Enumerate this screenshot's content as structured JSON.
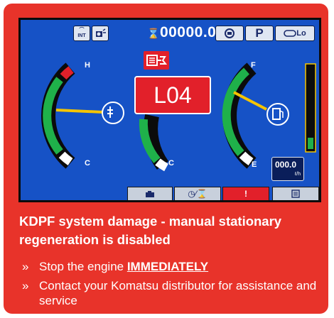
{
  "display": {
    "odometer": "00000.0",
    "odometer_unit": "h",
    "mode_p": "P",
    "mode_lo": "Lo",
    "int_label": "INT",
    "alert_code": "L04",
    "rate_value": "000.0",
    "rate_unit": "ℓ/h",
    "gauge_letters": {
      "coolant_high": "H",
      "coolant_cold": "C",
      "hyd_cold": "C",
      "fuel_full": "F",
      "fuel_empty": "E"
    },
    "bottom_buttons": [
      {
        "icon": "camera-icon"
      },
      {
        "icon": "clock-hourglass-icon"
      },
      {
        "label": "!"
      },
      {
        "icon": "list-icon"
      }
    ],
    "colors": {
      "screen_bg": "#1652c6",
      "alert_red": "#e2202a",
      "card_red": "#e8332a",
      "gauge_green": "#1fb14a",
      "needle": "#f5c400"
    }
  },
  "message": {
    "title": "KDPF system damage - manual stationary regeneration is disabled",
    "bullets": [
      {
        "prefix": "Stop the engine ",
        "strong": "IMMEDIATELY",
        "suffix": ""
      },
      {
        "prefix": "Contact your Komatsu distributor for assistance and service",
        "strong": "",
        "suffix": ""
      }
    ],
    "bullet_glyph": "»"
  }
}
